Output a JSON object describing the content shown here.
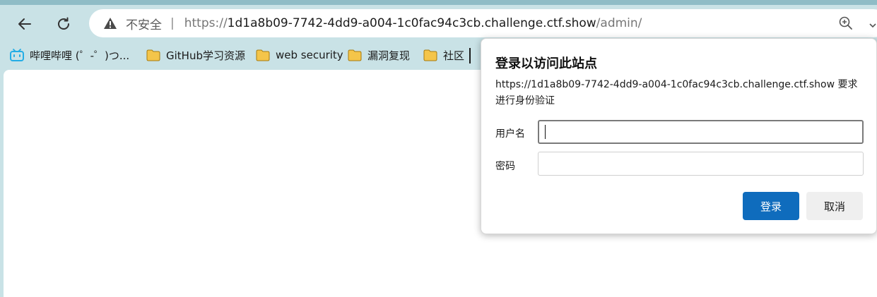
{
  "address_bar": {
    "security_label": "不安全",
    "separator": "|",
    "url_scheme": "https://",
    "url_host": "1d1a8b09-7742-4dd9-a004-1c0fac94c3cb.challenge.ctf.show",
    "url_path": "/admin/"
  },
  "bookmarks": {
    "items": [
      {
        "label": "哔哩哔哩 (゜-゜)つ...",
        "icon": "bilibili-icon"
      },
      {
        "label": "GitHub学习资源",
        "icon": "folder-icon"
      },
      {
        "label": "web security",
        "icon": "folder-icon"
      },
      {
        "label": "漏洞复现",
        "icon": "folder-icon"
      },
      {
        "label": "社区",
        "icon": "folder-icon"
      }
    ]
  },
  "auth_dialog": {
    "title": "登录以访问此站点",
    "message": "https://1d1a8b09-7742-4dd9-a004-1c0fac94c3cb.challenge.ctf.show 要求进行身份验证",
    "username_label": "用户名",
    "username_value": "",
    "password_label": "密码",
    "password_value": "",
    "login_label": "登录",
    "cancel_label": "取消"
  },
  "colors": {
    "chrome_background": "#c9e2e6",
    "accent": "#0f6cbd",
    "folder": "#f4c54a"
  }
}
